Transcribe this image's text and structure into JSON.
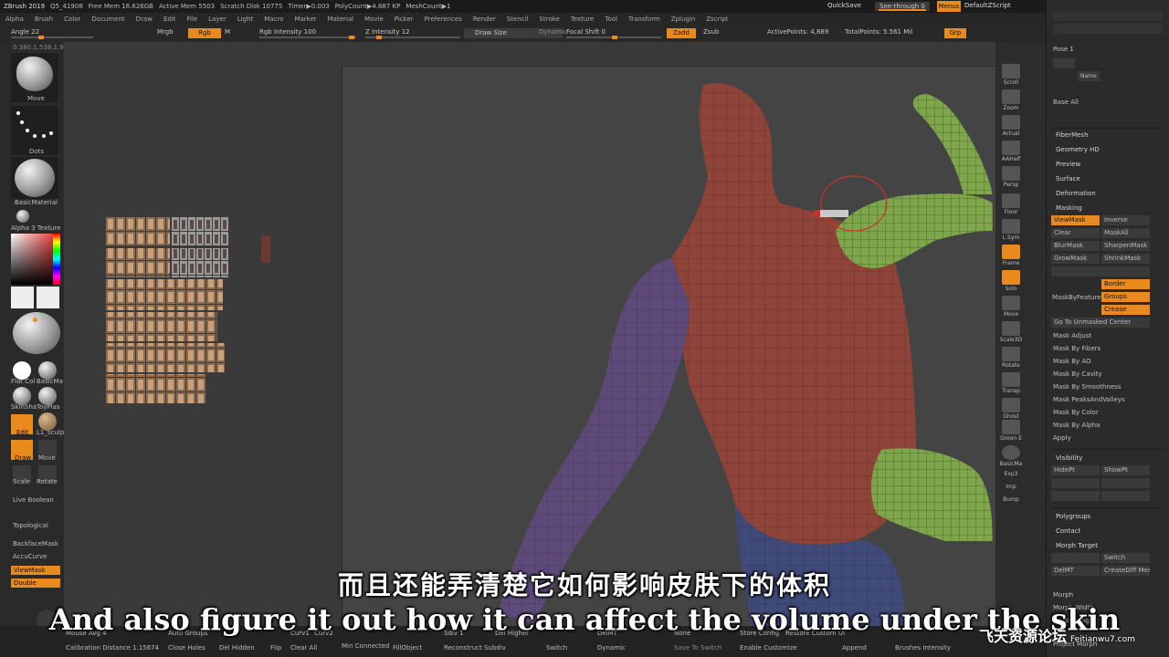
{
  "topbar": {
    "app_title": "ZBrush 2019",
    "doc_id": "Q5_41908",
    "free_mem": "Free Mem 16.626GB",
    "active_mem": "Active Mem 5503",
    "scratch_disk": "Scratch Disk 10775",
    "timer": "Timer▶0.003",
    "poly_count": "PolyCount▶4.887 KP",
    "mesh_count": "MeshCount▶1",
    "quicksave": "QuickSave",
    "see_through": "See-through  0",
    "menus": "Menus",
    "default_script": "DefaultZScript"
  },
  "menubar": [
    "Alpha",
    "Brush",
    "Color",
    "Document",
    "Draw",
    "Edit",
    "File",
    "Layer",
    "Light",
    "Macro",
    "Marker",
    "Material",
    "Movie",
    "Picker",
    "Preferences",
    "Render",
    "Stencil",
    "Stroke",
    "Texture",
    "Tool",
    "Transform",
    "Zplugin",
    "Zscript"
  ],
  "shelf": {
    "angle": "Angle 22",
    "mrgb": "Mrgb",
    "rgb": "Rgb",
    "m": "M",
    "rgb_intensity": "Rgb Intensity 100",
    "z_intensity": "Z Intensity 12",
    "draw_size": "Draw Size",
    "dynamic": "Dynamic",
    "focal_shift": "Focal Shift 0",
    "zadd": "Zadd",
    "zsub": "Zsub",
    "active_points": "ActivePoints: 4,889",
    "total_points": "TotalPoints: 5.561 Mil",
    "grp": "Grp",
    "coords": "0.380,1.538,1.908"
  },
  "left": {
    "brush_move": "Move",
    "stroke_dots": "Dots",
    "material": "BasicMaterial",
    "alpha_texture": "Alpha 3 Texture",
    "flat_color": "Flat Col",
    "basic_mat": "BasicMa",
    "skinshade": "SkinSha",
    "toy_plastic": "ToyPlas",
    "edit": "Edit",
    "draw": "Draw",
    "move": "Move",
    "scale": "Scale",
    "rotate": "Rotate",
    "live_boolean": "Live Boolean",
    "topological": "Topological",
    "backface_mask": "BackfaceMask",
    "accucurve": "AccuCurve",
    "viewmask": "ViewMask",
    "double": "Double",
    "material_sculpt": "L1_sculp"
  },
  "right_shelf": [
    "Scroll",
    "Zoom",
    "Actual",
    "AAHalf",
    "Persp",
    "Floor",
    "L.Sym",
    "Frame",
    "Solo",
    "Move",
    "Scale3D",
    "Rotate",
    "Transp",
    "Ghost",
    "Green E",
    "BasicMa",
    "Exp3",
    "Imp",
    "Bump"
  ],
  "palette": {
    "pose": "Pose 1",
    "name": "Name",
    "base_all": "Base All",
    "sections": [
      "FiberMesh",
      "Geometry HD",
      "Preview",
      "Surface",
      "Deformation",
      "Masking"
    ],
    "masking_buttons": [
      {
        "label": "ViewMask",
        "on": true
      },
      {
        "label": "Inverse",
        "on": false
      },
      {
        "label": "Clear",
        "on": false
      },
      {
        "label": "MaskAll",
        "on": false
      },
      {
        "label": "BlurMask",
        "on": false
      },
      {
        "label": "SharpenMask",
        "on": false
      },
      {
        "label": "GrowMask",
        "on": false
      },
      {
        "label": "ShrinkMask",
        "on": false
      }
    ],
    "mask_by_feature": "MaskByFeature",
    "feature_buttons": [
      "Border",
      "Groups",
      "Crease"
    ],
    "goto_unmasked": "Go To Unmasked Center",
    "mask_items": [
      "Mask Adjust",
      "Mask By Fibers",
      "Mask By AO",
      "Mask By Cavity",
      "Mask By Smoothness",
      "Mask PeaksAndValleys",
      "Mask By Color",
      "Mask By Alpha",
      "Apply"
    ],
    "visibility": "Visibility",
    "hidept": "HidePt",
    "showpt": "ShowPt",
    "polygroups": "Polygroups",
    "contact": "Contact",
    "morph_target": "Morph Target",
    "switch": "Switch",
    "delmt": "DelMT",
    "create_diff": "CreateDiff Mesh",
    "morph": "Morph",
    "morph_width": "Morph Width",
    "morph_height": "Morph Height",
    "project_morph": "Project Morph"
  },
  "bottom": {
    "mouse_avg": "Mouse Avg 4",
    "calib": "Calibration Distance 1.15674",
    "auto_groups": "Auto Groups",
    "close_holes": "Close Holes",
    "del_hidden": "Del Hidden",
    "flip": "Flip",
    "curv1": "Curv1",
    "curv2": "Curv2",
    "clear_all": "Clear All",
    "min_connected": "Min Connected",
    "fill_object": "FillObject",
    "reconstruct": "Reconstruct Subdiv",
    "sdiv": "Sdiv 1",
    "del_higher": "Del Higher",
    "switch": "Switch",
    "delmt": "DelMT",
    "dynamic": "Dynamic",
    "none": "None",
    "save_to": "Save To Switch",
    "store_config": "Store Config",
    "restore_custom": "Restore Custom UI",
    "enable_customize": "Enable Customize",
    "append": "Append",
    "brushes_intensity": "Brushes Intensity"
  },
  "subtitles": {
    "chinese": "而且还能弄清楚它如何影响皮肤下的体积",
    "english": "And also figure it out how it can affect the volume under the skin"
  },
  "watermark": {
    "name": "飞天资源论坛",
    "url": "Feitianwu7.com"
  },
  "colors": {
    "accent": "#e88a1e",
    "skin_red": "#8e4438",
    "arm_purple": "#5e4a79",
    "mask_green": "#7ea64a",
    "hip_blue": "#3f4a78"
  }
}
